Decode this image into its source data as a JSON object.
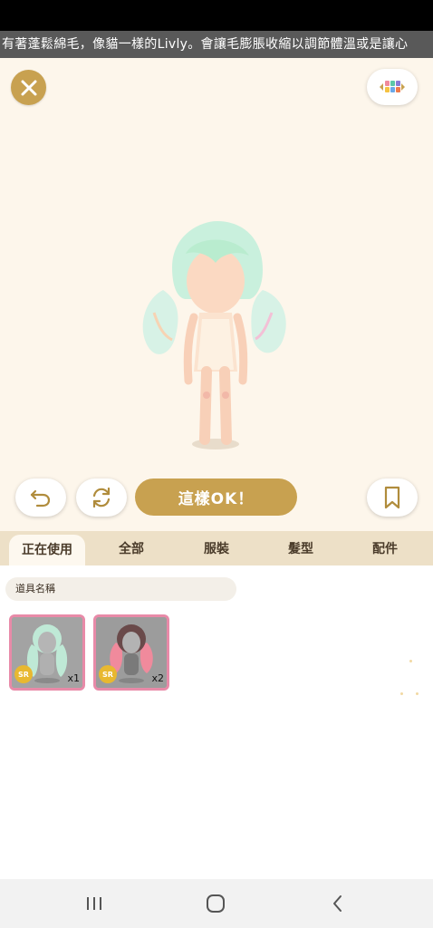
{
  "marquee": {
    "text": "有著蓬鬆綿毛，像貓一樣的Livly。會讓毛膨脹收縮以調節體溫或是讓心"
  },
  "stage": {
    "close_icon": "close-icon",
    "color_palette_icon": "color-palette-icon"
  },
  "actions": {
    "undo_icon": "undo-icon",
    "refresh_icon": "refresh-icon",
    "ok_label": "這樣OK！",
    "bookmark_icon": "bookmark-icon"
  },
  "tabs": [
    {
      "label": "正在使用",
      "active": true
    },
    {
      "label": "全部",
      "active": false
    },
    {
      "label": "服裝",
      "active": false
    },
    {
      "label": "髮型",
      "active": false
    },
    {
      "label": "配件",
      "active": false
    }
  ],
  "search": {
    "placeholder": "道具名稱"
  },
  "items": [
    {
      "rarity": "SR",
      "quantity": "x1",
      "hair_color": "#bfe9d6"
    },
    {
      "rarity": "SR",
      "quantity": "x2",
      "hair_color": "#f08a9c"
    }
  ],
  "colors": {
    "accent": "#c8a150",
    "selected_border": "#e88aa8",
    "tab_bar": "#ede0c7"
  }
}
